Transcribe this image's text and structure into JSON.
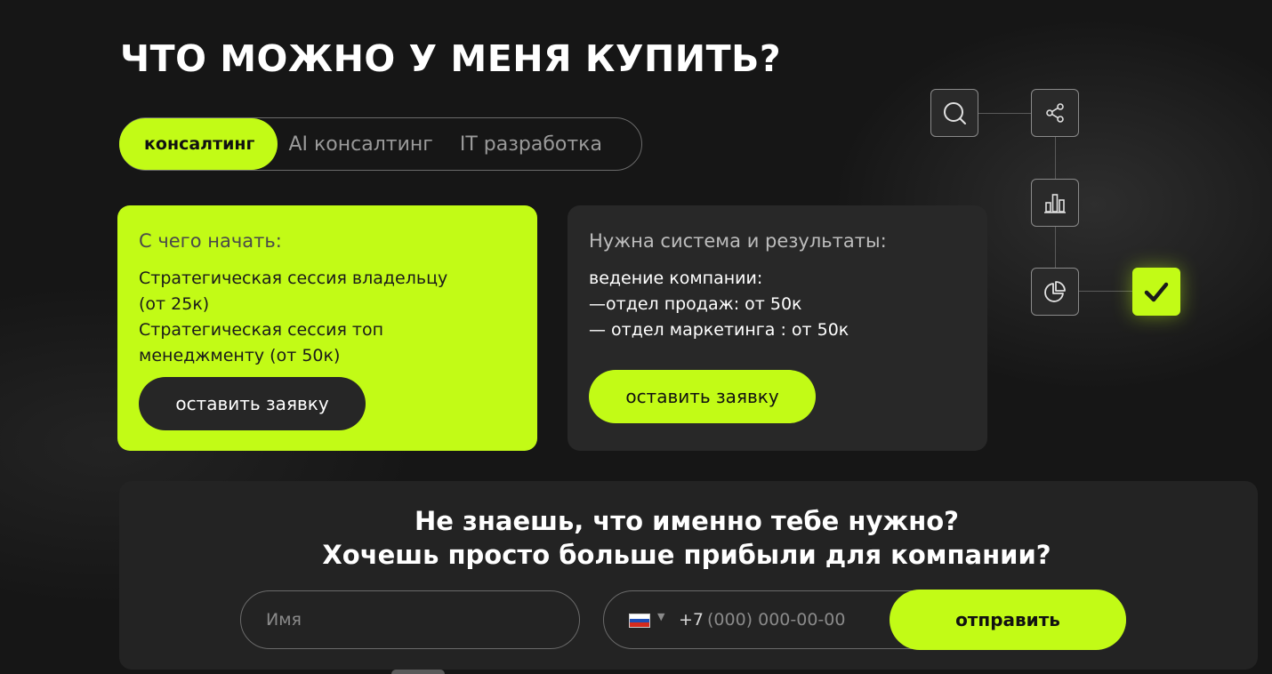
{
  "page": {
    "title": "ЧТО МОЖНО У МЕНЯ КУПИТЬ?"
  },
  "tabs": [
    {
      "label": "консалтинг",
      "active": true
    },
    {
      "label": "AI консалтинг",
      "active": false
    },
    {
      "label": "IT разработка",
      "active": false
    }
  ],
  "cards": [
    {
      "title": "С чего начать:",
      "lines": [
        "Стратегическая сессия владельцу",
        "(от 25к)",
        "Стратегическая сессия топ",
        "менеджменту (от 50к)"
      ],
      "button": "оставить заявку"
    },
    {
      "title": "Нужна система и результаты:",
      "lines": [
        "ведение компании:",
        "—отдел продаж: от 50к",
        "— отдел маркетинга : от 50к"
      ],
      "button": "оставить заявку"
    }
  ],
  "flow": {
    "icons": [
      "search-icon",
      "share-icon",
      "bar-chart-icon",
      "pie-chart-icon",
      "checkmark-icon"
    ],
    "accent": "#c2fb16"
  },
  "cta": {
    "title_line1": "Не знаешь, что именно тебе нужно?",
    "title_line2": "Хочешь просто больше прибыли для компании?",
    "name_placeholder": "Имя",
    "phone_prefix": "+7",
    "phone_placeholder": "(000) 000-00-00",
    "submit": "отправить"
  },
  "colors": {
    "accent": "#c2fb16",
    "background": "#161616",
    "card_dark": "#282828"
  }
}
